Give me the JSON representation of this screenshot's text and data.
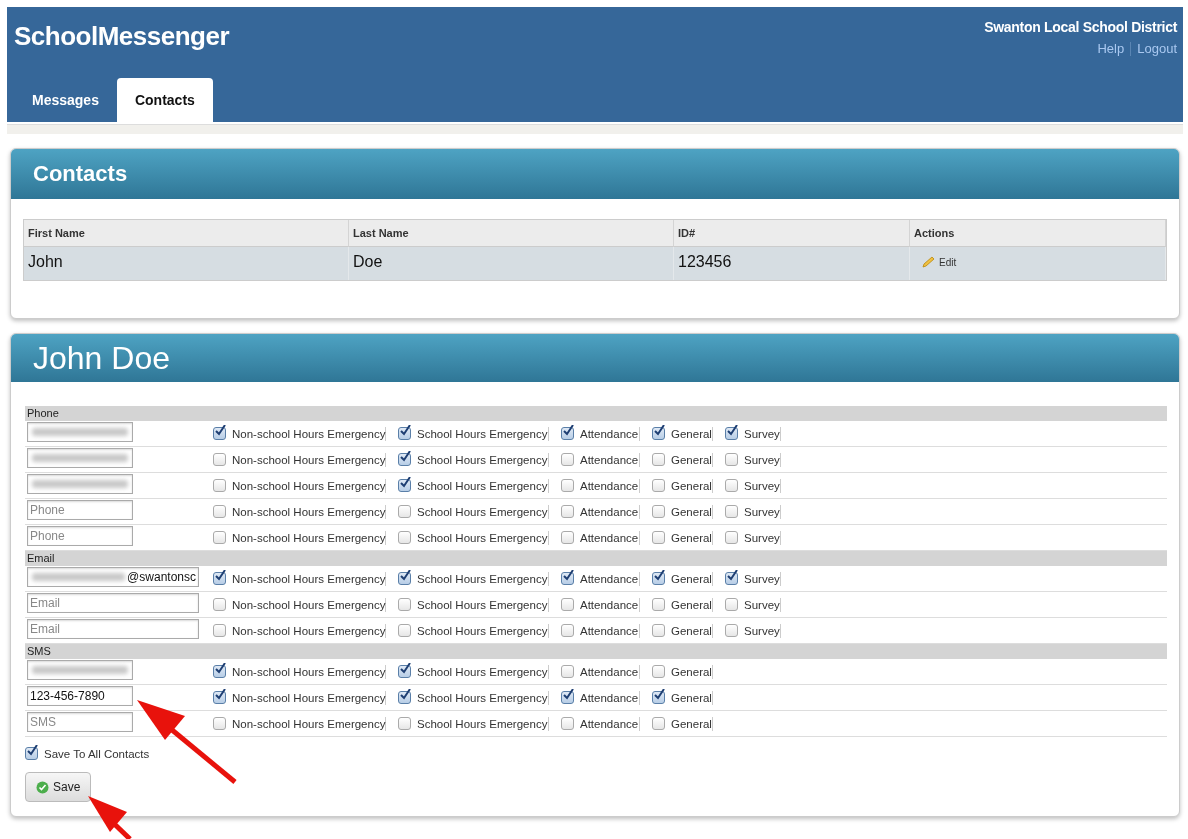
{
  "header": {
    "logo": "SchoolMessenger",
    "district": "Swanton Local School District",
    "links": [
      "Help",
      "Logout"
    ]
  },
  "tabs": [
    {
      "label": "Messages",
      "selected": false
    },
    {
      "label": "Contacts",
      "selected": true
    }
  ],
  "contacts_panel": {
    "title": "Contacts",
    "columns": [
      "First Name",
      "Last Name",
      "ID#",
      "Actions"
    ],
    "rows": [
      {
        "cells": [
          "John",
          "Doe",
          "123456"
        ],
        "action": "Edit"
      }
    ]
  },
  "detail_panel": {
    "title": "John Doe",
    "sections": [
      {
        "label": "Phone",
        "rows": [
          {
            "field": {
              "blurred": true
            },
            "options": [
              {
                "label": "Non-school Hours Emergency",
                "checked": true
              },
              {
                "label": "School Hours Emergency",
                "checked": true
              },
              {
                "label": "Attendance",
                "checked": true
              },
              {
                "label": "General",
                "checked": true
              },
              {
                "label": "Survey",
                "checked": true
              }
            ]
          },
          {
            "field": {
              "blurred": true
            },
            "options": [
              {
                "label": "Non-school Hours Emergency",
                "checked": false
              },
              {
                "label": "School Hours Emergency",
                "checked": true
              },
              {
                "label": "Attendance",
                "checked": false
              },
              {
                "label": "General",
                "checked": false
              },
              {
                "label": "Survey",
                "checked": false
              }
            ]
          },
          {
            "field": {
              "blurred": true
            },
            "options": [
              {
                "label": "Non-school Hours Emergency",
                "checked": false
              },
              {
                "label": "School Hours Emergency",
                "checked": true
              },
              {
                "label": "Attendance",
                "checked": false
              },
              {
                "label": "General",
                "checked": false
              },
              {
                "label": "Survey",
                "checked": false
              }
            ]
          },
          {
            "field": {
              "placeholder": "Phone"
            },
            "options": [
              {
                "label": "Non-school Hours Emergency",
                "checked": false
              },
              {
                "label": "School Hours Emergency",
                "checked": false
              },
              {
                "label": "Attendance",
                "checked": false
              },
              {
                "label": "General",
                "checked": false
              },
              {
                "label": "Survey",
                "checked": false
              }
            ]
          },
          {
            "field": {
              "placeholder": "Phone"
            },
            "options": [
              {
                "label": "Non-school Hours Emergency",
                "checked": false
              },
              {
                "label": "School Hours Emergency",
                "checked": false
              },
              {
                "label": "Attendance",
                "checked": false
              },
              {
                "label": "General",
                "checked": false
              },
              {
                "label": "Survey",
                "checked": false
              }
            ]
          }
        ]
      },
      {
        "label": "Email",
        "rows": [
          {
            "field": {
              "blurred": true,
              "value": "@swantonsc",
              "wide": true
            },
            "options": [
              {
                "label": "Non-school Hours Emergency",
                "checked": true
              },
              {
                "label": "School Hours Emergency",
                "checked": true
              },
              {
                "label": "Attendance",
                "checked": true
              },
              {
                "label": "General",
                "checked": true
              },
              {
                "label": "Survey",
                "checked": true
              }
            ]
          },
          {
            "field": {
              "placeholder": "Email",
              "wide": true
            },
            "options": [
              {
                "label": "Non-school Hours Emergency",
                "checked": false
              },
              {
                "label": "School Hours Emergency",
                "checked": false
              },
              {
                "label": "Attendance",
                "checked": false
              },
              {
                "label": "General",
                "checked": false
              },
              {
                "label": "Survey",
                "checked": false
              }
            ]
          },
          {
            "field": {
              "placeholder": "Email",
              "wide": true
            },
            "options": [
              {
                "label": "Non-school Hours Emergency",
                "checked": false
              },
              {
                "label": "School Hours Emergency",
                "checked": false
              },
              {
                "label": "Attendance",
                "checked": false
              },
              {
                "label": "General",
                "checked": false
              },
              {
                "label": "Survey",
                "checked": false
              }
            ]
          }
        ]
      },
      {
        "label": "SMS",
        "rows": [
          {
            "field": {
              "blurred": true
            },
            "options": [
              {
                "label": "Non-school Hours Emergency",
                "checked": true
              },
              {
                "label": "School Hours Emergency",
                "checked": true
              },
              {
                "label": "Attendance",
                "checked": false
              },
              {
                "label": "General",
                "checked": false
              }
            ]
          },
          {
            "field": {
              "value": "123-456-7890"
            },
            "options": [
              {
                "label": "Non-school Hours Emergency",
                "checked": true
              },
              {
                "label": "School Hours Emergency",
                "checked": true
              },
              {
                "label": "Attendance",
                "checked": true
              },
              {
                "label": "General",
                "checked": true
              }
            ]
          },
          {
            "field": {
              "placeholder": "SMS"
            },
            "options": [
              {
                "label": "Non-school Hours Emergency",
                "checked": false
              },
              {
                "label": "School Hours Emergency",
                "checked": false
              },
              {
                "label": "Attendance",
                "checked": false
              },
              {
                "label": "General",
                "checked": false
              }
            ]
          }
        ]
      }
    ],
    "save_all": {
      "label": "Save To All Contacts",
      "checked": true
    },
    "save_button": "Save"
  }
}
